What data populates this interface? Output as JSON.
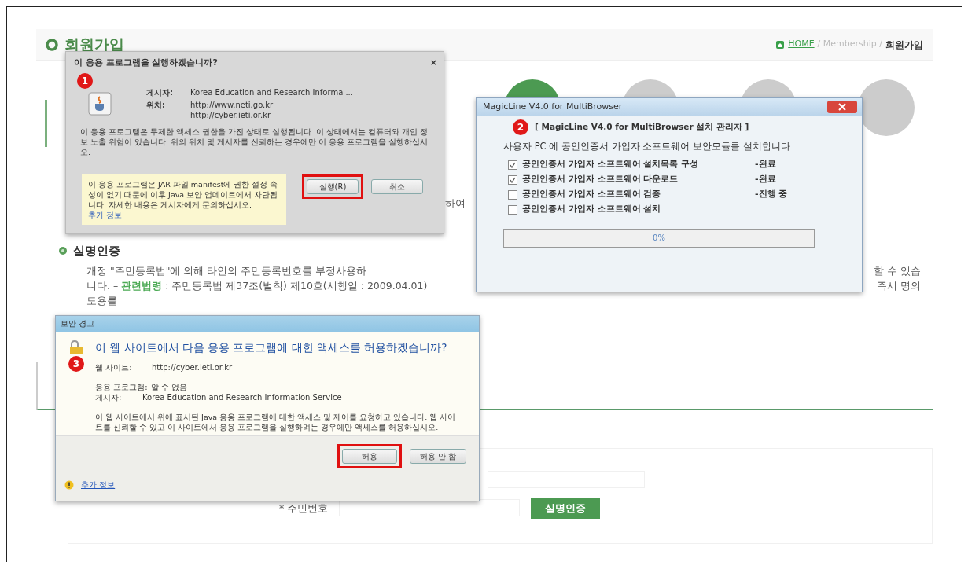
{
  "page": {
    "title": "회원가입",
    "breadcrumb": [
      {
        "label": "HOME",
        "kind": "home"
      },
      {
        "label": "/ Membership /",
        "kind": "path"
      },
      {
        "label": "회원가입",
        "kind": "current"
      }
    ],
    "steps": [
      {
        "selected": true
      },
      {
        "selected": false
      },
      {
        "selected": false
      },
      {
        "selected": false
      }
    ],
    "fragment": "하여",
    "section": {
      "title": "실명인증",
      "lines": [
        [
          "개정 \"주민등록법\"에 의해 타인의 주민등록번호를 부정사용하",
          "할 수 있습"
        ],
        [
          "니다. – **관련법령** : 주민등록법 제37조(벌칙) 제10호(시행일 : 2009.04.01)",
          "즉시 명의"
        ],
        [
          "도용를"
        ]
      ]
    },
    "form": {
      "label": "* 주민번호",
      "button": "실명인증"
    }
  },
  "java_dialog": {
    "title": "이 응용 프로그램을 실행하겠습니까?",
    "close": "×",
    "badge": "1",
    "fields": [
      {
        "label": "게시자:",
        "values": [
          "Korea Education and Research Informa ..."
        ]
      },
      {
        "label": "위치:",
        "values": [
          "http://www.neti.go.kr",
          "http://cyber.ieti.or.kr"
        ]
      }
    ],
    "message": "이 응용 프로그램은 무제한 액세스 권한을 가진 상태로 실행됩니다. 이 상태에서는 컴퓨터와 개인 정보 노출 위험이 있습니다. 위의 위치 및 게시자를 신뢰하는 경우에만 이 응용 프로그램을 실행하십시오.",
    "note": "이 응용 프로그램은 JAR 파일 manifest에 권한 설정 속성이 없기 때문에 이후 Java 보안 업데이트에서 차단됩니다. 자세한 내용은 게시자에게 문의하십시오.",
    "note_link": "추가 정보",
    "buttons": [
      {
        "label": "실행(R)",
        "highlighted": true
      },
      {
        "label": "취소",
        "highlighted": false
      }
    ]
  },
  "installer_dialog": {
    "title": "MagicLine V4.0 for MultiBrowser",
    "badge": "2",
    "heading": "[ MagicLine V4.0 for MultiBrowser 설치 관리자 ]",
    "message": "사용자 PC 에 공인인증서 가입자 소프트웨어 보안모듈를 설치합니다",
    "tasks": [
      {
        "label": "공인인증서 가입자 소프트웨어 설치목록 구성",
        "status": "-완료",
        "checked": true
      },
      {
        "label": "공인인증서 가입자 소프트웨어 다운로드",
        "status": "-완료",
        "checked": true
      },
      {
        "label": "공인인증서 가입자 소프트웨어 검증",
        "status": "-진행 중",
        "checked": false
      },
      {
        "label": "공인인증서 가입자 소프트웨어 설치",
        "checked": false
      }
    ],
    "progress": {
      "level": 0,
      "reading": "0%"
    }
  },
  "security_dialog": {
    "title": "보안 경고",
    "badge": "3",
    "heading": "이 웹 사이트에서 다음 응용 프로그램에 대한 액세스를 허용하겠습니까?",
    "fields": [
      {
        "label": "웹 사이트:",
        "value": "http://cyber.ieti.or.kr"
      },
      {
        "label": "응용 프로그램:",
        "value": "알 수 없음"
      },
      {
        "label": "게시자:",
        "value": "Korea Education and Research Information Service"
      }
    ],
    "message": "이 웹 사이트에서 위에 표시된 Java 응용 프로그램에 대한 액세스 및 제어를 요청하고 있습니다. 웹 사이트를 신뢰할 수 있고 이 사이트에서 응용 프로그램을 실행하려는 경우에만 액세스를 허용하십시오.",
    "buttons": [
      {
        "label": "허용",
        "highlighted": true
      },
      {
        "label": "허용 안 함",
        "highlighted": false
      }
    ],
    "footer_link": "추가 정보"
  }
}
